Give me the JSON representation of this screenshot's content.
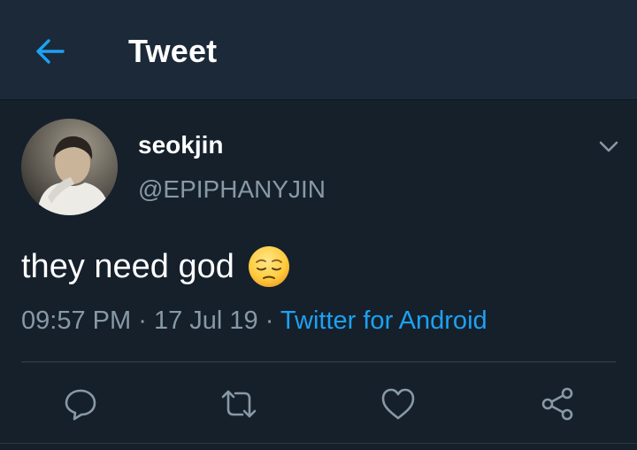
{
  "header": {
    "title": "Tweet",
    "back_icon": "arrow-left-icon",
    "accent_color": "#1da1f2"
  },
  "tweet": {
    "author": {
      "display_name": "seokjin",
      "handle": "@EPIPHANYJIN",
      "avatar": "profile-photo"
    },
    "text": "they need god",
    "emoji": "pensive-face-emoji",
    "time": "09:57 PM",
    "separator": "·",
    "date": "17 Jul 19",
    "source": "Twitter for Android",
    "menu_icon": "chevron-down-icon"
  },
  "actions": [
    {
      "name": "reply",
      "icon": "reply-icon"
    },
    {
      "name": "retweet",
      "icon": "retweet-icon"
    },
    {
      "name": "like",
      "icon": "heart-icon"
    },
    {
      "name": "share",
      "icon": "share-icon"
    }
  ],
  "colors": {
    "background": "#15202b",
    "header_background": "#1c2938",
    "secondary_text": "#8899a6",
    "link": "#1da1f2",
    "icon": "#8899a6"
  }
}
